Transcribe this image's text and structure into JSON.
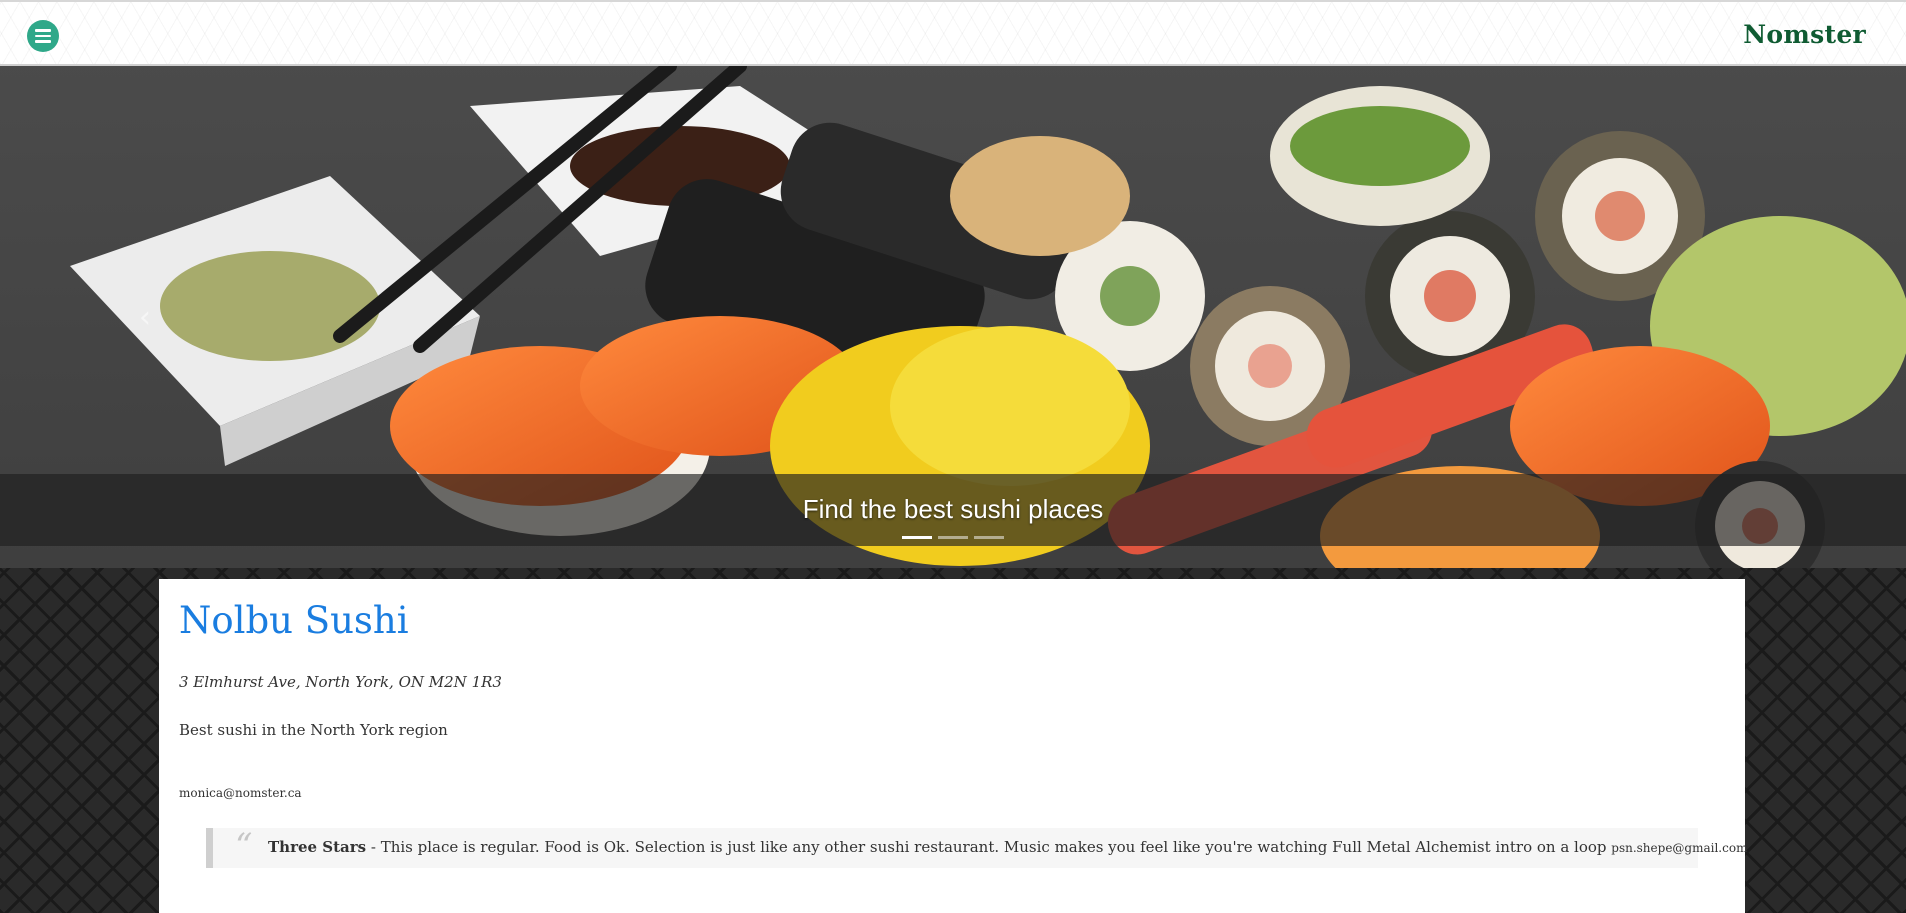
{
  "header": {
    "brand": "Nomster",
    "menu_icon": "menu-icon"
  },
  "carousel": {
    "caption": "Find the best sushi places",
    "prev_icon": "chevron-left-icon",
    "slide_count": 3,
    "active_slide": 1
  },
  "place": {
    "name": "Nolbu Sushi",
    "address": "3 Elmhurst Ave, North York, ON M2N 1R3",
    "description": "Best sushi in the North York region",
    "email": "monica@nomster.ca"
  },
  "review": {
    "rating": "Three Stars",
    "separator": " - ",
    "message": "This place is regular. Food is Ok. Selection is just like any other sushi restaurant. Music makes you feel like you're watching Full Metal Alchemist intro on a loop ",
    "reviewer": "psn.shepe@gmail.com"
  },
  "colors": {
    "brand": "#0f5b32",
    "menu_button": "#2fa889",
    "place_name": "#1a7de0"
  }
}
